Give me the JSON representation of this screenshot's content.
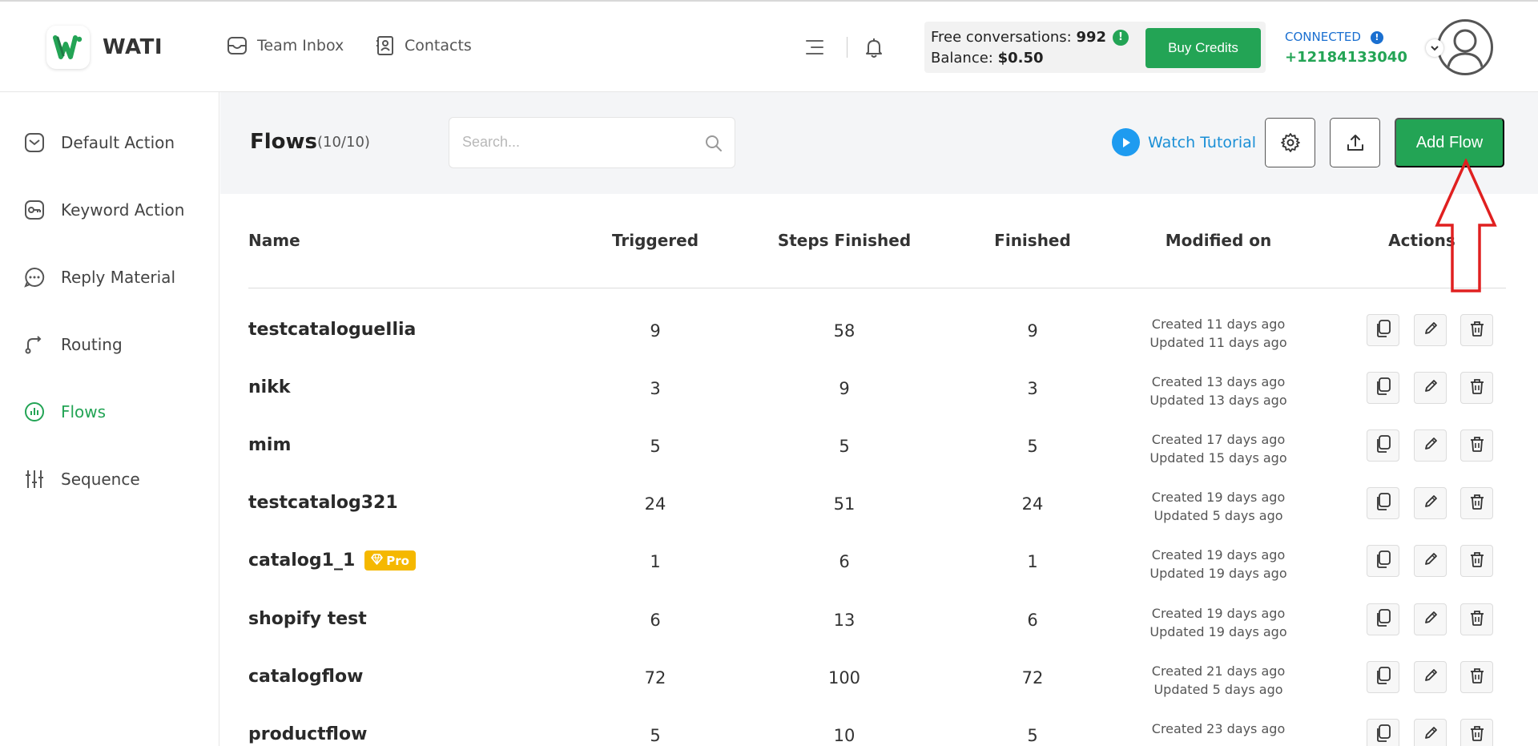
{
  "header": {
    "brand": "WATI",
    "nav": [
      {
        "label": "Team Inbox",
        "icon": "inbox-icon"
      },
      {
        "label": "Contacts",
        "icon": "contacts-icon"
      }
    ],
    "free_conversations_label": "Free conversations:",
    "free_conversations_value": "992",
    "balance_label": "Balance:",
    "balance_value": "$0.50",
    "buy_credits": "Buy Credits",
    "connected_label": "CONNECTED",
    "phone": "+12184133040",
    "info_glyph": "!",
    "accent": "#23a455"
  },
  "sidebar": {
    "items": [
      {
        "label": "Default Action",
        "icon": "default-action-icon",
        "active": false
      },
      {
        "label": "Keyword Action",
        "icon": "keyword-action-icon",
        "active": false
      },
      {
        "label": "Reply Material",
        "icon": "reply-material-icon",
        "active": false
      },
      {
        "label": "Routing",
        "icon": "routing-icon",
        "active": false
      },
      {
        "label": "Flows",
        "icon": "flows-icon",
        "active": true
      },
      {
        "label": "Sequence",
        "icon": "sequence-icon",
        "active": false
      }
    ]
  },
  "toolbar": {
    "title": "Flows",
    "count": "(10/10)",
    "search_placeholder": "Search...",
    "watch_tutorial": "Watch Tutorial",
    "add_flow": "Add Flow"
  },
  "table": {
    "columns": {
      "name": "Name",
      "triggered": "Triggered",
      "steps": "Steps Finished",
      "finished": "Finished",
      "modified": "Modified on",
      "actions": "Actions"
    },
    "rows": [
      {
        "name": "testcatalogueIlia",
        "triggered": "9",
        "steps": "58",
        "finished": "9",
        "created": "Created 11 days ago",
        "updated": "Updated 11 days ago",
        "pro": ""
      },
      {
        "name": "nikk",
        "triggered": "3",
        "steps": "9",
        "finished": "3",
        "created": "Created 13 days ago",
        "updated": "Updated 13 days ago",
        "pro": ""
      },
      {
        "name": "mim",
        "triggered": "5",
        "steps": "5",
        "finished": "5",
        "created": "Created 17 days ago",
        "updated": "Updated 15 days ago",
        "pro": ""
      },
      {
        "name": "testcatalog321",
        "triggered": "24",
        "steps": "51",
        "finished": "24",
        "created": "Created 19 days ago",
        "updated": "Updated 5 days ago",
        "pro": ""
      },
      {
        "name": "catalog1_1",
        "triggered": "1",
        "steps": "6",
        "finished": "1",
        "created": "Created 19 days ago",
        "updated": "Updated 19 days ago",
        "pro": "Pro"
      },
      {
        "name": "shopify test",
        "triggered": "6",
        "steps": "13",
        "finished": "6",
        "created": "Created 19 days ago",
        "updated": "Updated 19 days ago",
        "pro": ""
      },
      {
        "name": "catalogflow",
        "triggered": "72",
        "steps": "100",
        "finished": "72",
        "created": "Created 21 days ago",
        "updated": "Updated 5 days ago",
        "pro": ""
      },
      {
        "name": "productflow",
        "triggered": "5",
        "steps": "10",
        "finished": "5",
        "created": "Created 23 days ago",
        "updated": "",
        "pro": ""
      }
    ]
  }
}
